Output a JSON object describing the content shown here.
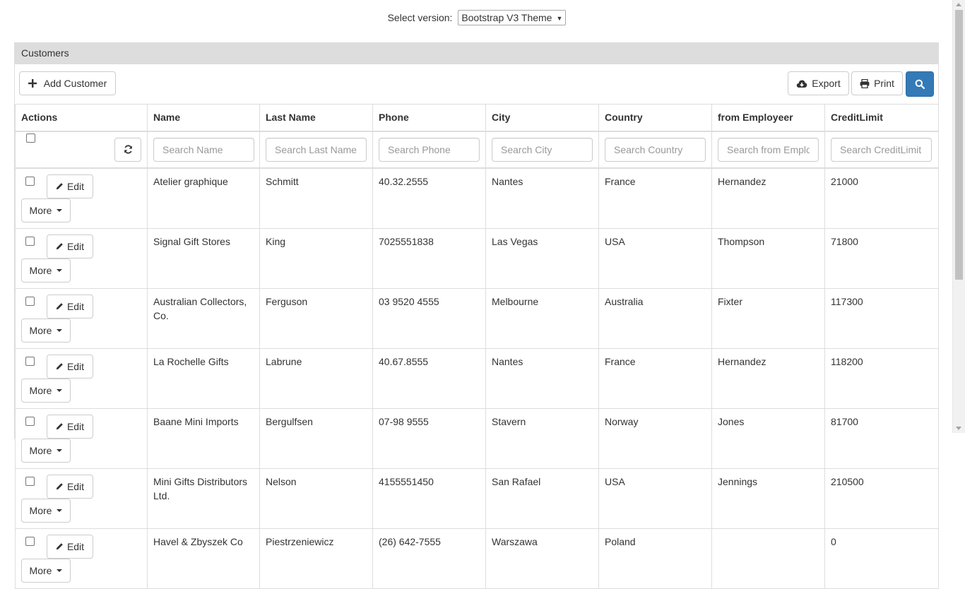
{
  "version_selector": {
    "label": "Select version:",
    "selected": "Bootstrap V3 Theme"
  },
  "panel": {
    "title": "Customers"
  },
  "toolbar": {
    "add_label": "Add Customer",
    "export_label": "Export",
    "print_label": "Print"
  },
  "table": {
    "columns": [
      "Actions",
      "Name",
      "Last Name",
      "Phone",
      "City",
      "Country",
      "from Employeer",
      "CreditLimit"
    ],
    "placeholders": [
      "Search Name",
      "Search Last Name",
      "Search Phone",
      "Search City",
      "Search Country",
      "Search from Employeer",
      "Search CreditLimit"
    ],
    "edit_label": "Edit",
    "more_label": "More",
    "rows": [
      {
        "name": "Atelier graphique",
        "last_name": "Schmitt",
        "phone": "40.32.2555",
        "city": "Nantes",
        "country": "France",
        "employeer": "Hernandez",
        "credit": "21000"
      },
      {
        "name": "Signal Gift Stores",
        "last_name": "King",
        "phone": "7025551838",
        "city": "Las Vegas",
        "country": "USA",
        "employeer": "Thompson",
        "credit": "71800"
      },
      {
        "name": "Australian Collectors, Co.",
        "last_name": "Ferguson",
        "phone": "03 9520 4555",
        "city": "Melbourne",
        "country": "Australia",
        "employeer": "Fixter",
        "credit": "117300"
      },
      {
        "name": "La Rochelle Gifts",
        "last_name": "Labrune",
        "phone": "40.67.8555",
        "city": "Nantes",
        "country": "France",
        "employeer": "Hernandez",
        "credit": "118200"
      },
      {
        "name": "Baane Mini Imports",
        "last_name": "Bergulfsen",
        "phone": "07-98 9555",
        "city": "Stavern",
        "country": "Norway",
        "employeer": "Jones",
        "credit": "81700"
      },
      {
        "name": "Mini Gifts Distributors Ltd.",
        "last_name": "Nelson",
        "phone": "4155551450",
        "city": "San Rafael",
        "country": "USA",
        "employeer": "Jennings",
        "credit": "210500"
      },
      {
        "name": "Havel & Zbyszek Co",
        "last_name": "Piestrzeniewicz",
        "phone": "(26) 642-7555",
        "city": "Warszawa",
        "country": "Poland",
        "employeer": "",
        "credit": "0"
      }
    ]
  },
  "colors": {
    "primary": "#337ab7",
    "heading_bg": "#dddddd",
    "border": "#dddddd"
  }
}
